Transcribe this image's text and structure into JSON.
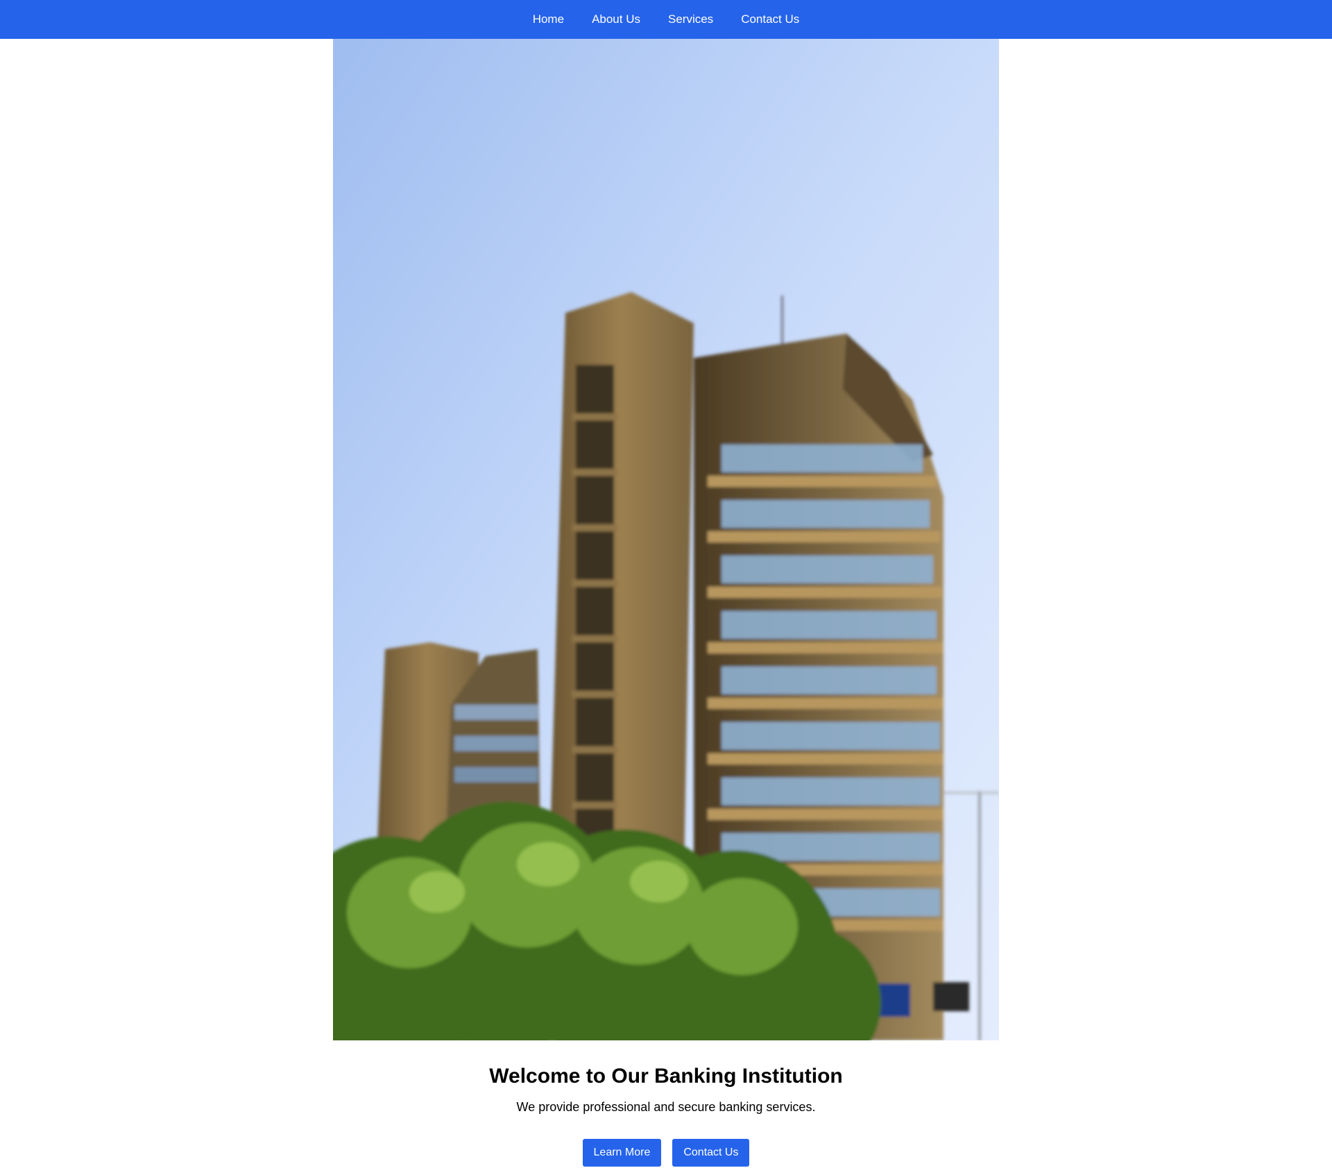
{
  "nav": {
    "items": [
      {
        "label": "Home"
      },
      {
        "label": "About Us"
      },
      {
        "label": "Services"
      },
      {
        "label": "Contact Us"
      }
    ]
  },
  "hero": {
    "title": "Welcome to Our Banking Institution",
    "subtitle": "We provide professional and secure banking services.",
    "buttons": {
      "learn_more": "Learn More",
      "contact_us": "Contact Us"
    }
  },
  "colors": {
    "primary": "#2563eb",
    "button_text": "#ffffff",
    "page_background": "#ffffff"
  }
}
